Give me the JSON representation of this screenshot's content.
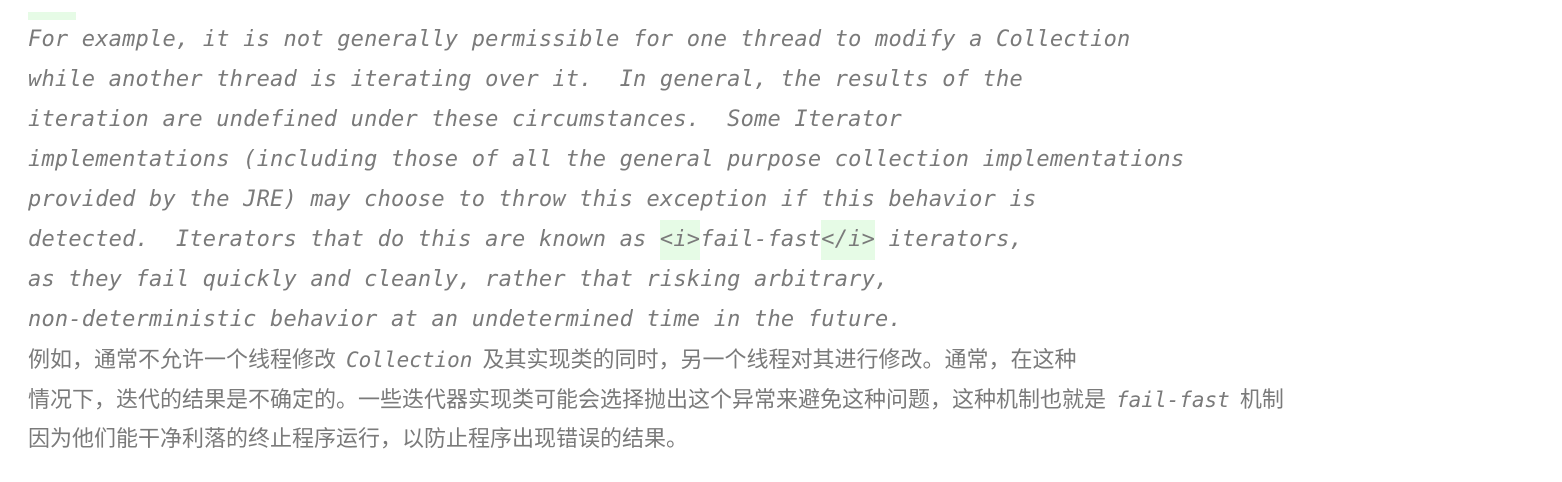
{
  "english_lines": [
    "For example, it is not generally permissible for one thread to modify a Collection",
    "while another thread is iterating over it.  In general, the results of the",
    "iteration are undefined under these circumstances.  Some Iterator",
    "implementations (including those of all the general purpose collection implementations",
    "provided by the JRE) may choose to throw this exception if this behavior is"
  ],
  "line6": {
    "before": "detected.  Iterators that do this are known as ",
    "tag_open": "<i>",
    "term": "fail-fast",
    "tag_close": "</i>",
    "after": " iterators,"
  },
  "english_lines_end": [
    "as they fail quickly and cleanly, rather that risking arbitrary,",
    "non-deterministic behavior at an undetermined time in the future."
  ],
  "chinese": {
    "line1_before": "例如，通常不允许一个线程修改",
    "line1_code": "Collection",
    "line1_after": "及其实现类的同时，另一个线程对其进行修改。通常，在这种",
    "line2_before": "情况下，迭代的结果是不确定的。一些迭代器实现类可能会选择抛出这个异常来避免这种问题，这种机制也就是",
    "line2_code": "fail-fast",
    "line2_after": "机制",
    "line3": "因为他们能干净利落的终止程序运行，以防止程序出现错误的结果。"
  }
}
